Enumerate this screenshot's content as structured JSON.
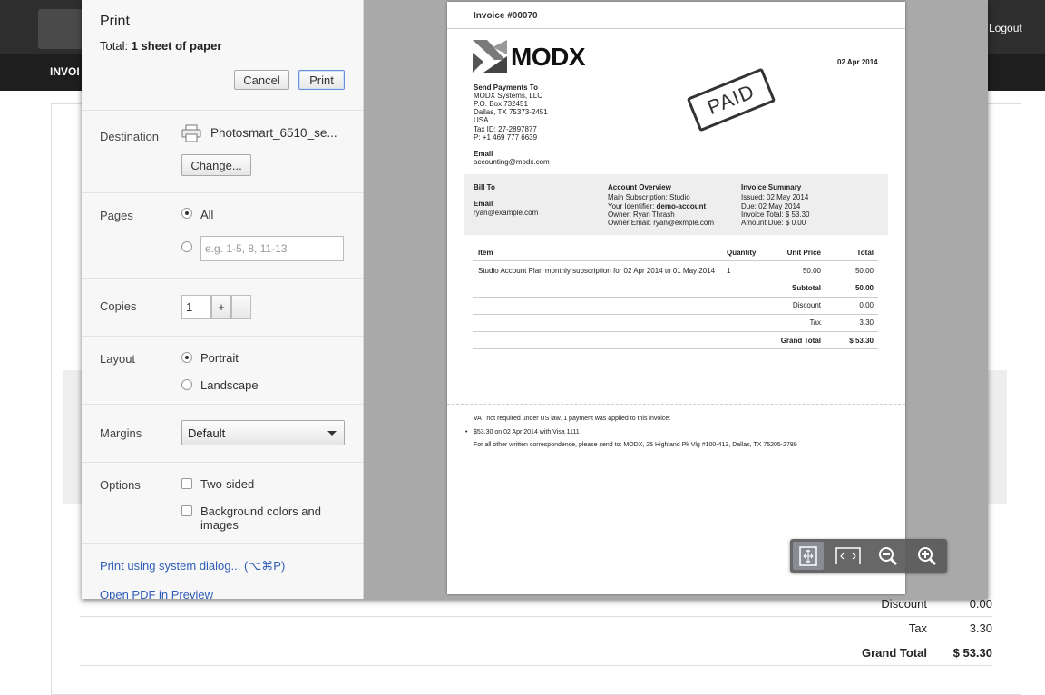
{
  "background_app": {
    "logout_label": "Logout",
    "nav_label": "INVOI",
    "totals": [
      {
        "label": "Discount",
        "value": "0.00"
      },
      {
        "label": "Tax",
        "value": "3.30"
      },
      {
        "label": "Grand Total",
        "value": "$ 53.30"
      }
    ]
  },
  "print_dialog": {
    "title": "Print",
    "total_label": "Total:",
    "total_value": "1 sheet of paper",
    "cancel_label": "Cancel",
    "print_label": "Print",
    "destination": {
      "label": "Destination",
      "printer": "Photosmart_6510_se...",
      "change_label": "Change..."
    },
    "pages": {
      "label": "Pages",
      "all_label": "All",
      "range_placeholder": "e.g. 1-5, 8, 11-13",
      "selected": "All"
    },
    "copies": {
      "label": "Copies",
      "value": "1",
      "plus": "+",
      "minus": "–"
    },
    "layout": {
      "label": "Layout",
      "portrait": "Portrait",
      "landscape": "Landscape",
      "selected": "Portrait"
    },
    "margins": {
      "label": "Margins",
      "value": "Default"
    },
    "options": {
      "label": "Options",
      "two_sided": "Two-sided",
      "background_line1": "Background colors and",
      "background_line2": "images"
    },
    "system_dialog_link": "Print using system dialog... (⌥⌘P)",
    "open_pdf_link": "Open PDF in Preview"
  },
  "invoice": {
    "header": "Invoice #00070",
    "brand": "MODX",
    "date": "02 Apr 2014",
    "stamp": "PAID",
    "send_payments": {
      "title": "Send Payments To",
      "lines": [
        "MODX Systems, LLC",
        "P.O. Box 732451",
        "Dallas, TX 75373-2451",
        "USA",
        "Tax ID: 27-2897877",
        "P: +1 469 777 6639"
      ]
    },
    "email_label": "Email",
    "email": "accounting@modx.com",
    "bill_to": {
      "title": "Bill To",
      "email_label": "Email",
      "email": "ryan@example.com"
    },
    "account_overview": {
      "title": "Account Overview",
      "lines": [
        "Main Subscription: Studio",
        "Your Identifier: ",
        "Owner: Ryan Thrash",
        "Owner Email: ryan@exmple.com"
      ],
      "identifier": "demo-account"
    },
    "invoice_summary": {
      "title": "Invoice Summary",
      "lines": [
        "Issued: 02 May 2014",
        "Due: 02 May 2014",
        "Invoice Total: $ 53.30",
        "Amount Due: $ 0.00"
      ]
    },
    "table": {
      "headers": [
        "Item",
        "Quantity",
        "Unit Price",
        "Total"
      ],
      "row": [
        "Studio Account Plan monthly subscription for 02 Apr 2014 to 01 May 2014",
        "1",
        "50.00",
        "50.00"
      ],
      "summary": [
        {
          "label": "Subtotal",
          "value": "50.00"
        },
        {
          "label": "Discount",
          "value": "0.00"
        },
        {
          "label": "Tax",
          "value": "3.30"
        },
        {
          "label": "Grand Total",
          "value": "$ 53.30"
        }
      ]
    },
    "footer": {
      "vat_note": "VAT not required under US law. 1 payment was applied to this invoice:",
      "payment": "$53.30 on 02 Apr 2014 with Visa 1111",
      "correspondence": "For all other written correspondence, please send to: MODX, 25 Highland Pk Vlg #100-413, Dallas, TX 75205-2789"
    }
  },
  "zoom_controls": {
    "icons": [
      "fit-page-icon",
      "fit-width-icon",
      "zoom-out-icon",
      "zoom-in-icon"
    ]
  }
}
